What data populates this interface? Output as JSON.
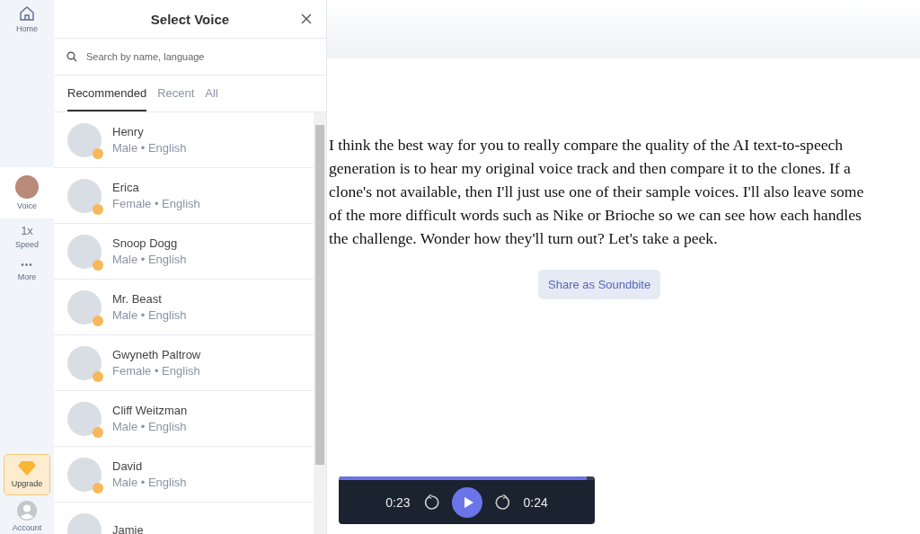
{
  "nav": [
    {
      "kind": "icon",
      "label": "Home",
      "selected": false
    },
    {
      "kind": "avatar",
      "label": "Voice",
      "selected": true
    },
    {
      "kind": "text",
      "glyph": "1x",
      "label": "Speed",
      "selected": false
    },
    {
      "kind": "dots",
      "glyph": "•••",
      "label": "More",
      "selected": false
    }
  ],
  "nav_bottom": [
    {
      "kind": "upgrade",
      "label": "Upgrade"
    },
    {
      "kind": "account",
      "label": "Account"
    }
  ],
  "panel": {
    "title": "Select Voice",
    "search": {
      "placeholder": "Search by name, language"
    },
    "tabs": [
      {
        "label": "Recommended",
        "selected": true
      },
      {
        "label": "Recent",
        "selected": false
      },
      {
        "label": "All",
        "selected": false
      }
    ],
    "voices": [
      {
        "name": "Henry",
        "details": "Male • English",
        "premium": true
      },
      {
        "name": "Erica",
        "details": "Female • English",
        "premium": true
      },
      {
        "name": "Snoop Dogg",
        "details": "Male • English",
        "premium": true
      },
      {
        "name": "Mr. Beast",
        "details": "Male • English",
        "premium": true
      },
      {
        "name": "Gwyneth Paltrow",
        "details": "Female • English",
        "premium": true
      },
      {
        "name": "Cliff Weitzman",
        "details": "Male • English",
        "premium": true
      },
      {
        "name": "David",
        "details": "Male • English",
        "premium": true
      },
      {
        "name": "Jamie"
      }
    ]
  },
  "document": {
    "text": "I think the best way for you to really compare the quality of the AI text-to-speech generation is to hear my original voice track and then compare it to the clones. If a clone's not available, then I'll just use one of their sample voices. I'll also leave some of the more difficult words such as Nike or Brioche so we can see how each handles the challenge. Wonder how they'll turn out? Let's take a peek.",
    "share_button": "Share as Soundbite"
  },
  "player": {
    "elapsed": "0:23",
    "remaining": "0:24",
    "level": 0.97
  }
}
